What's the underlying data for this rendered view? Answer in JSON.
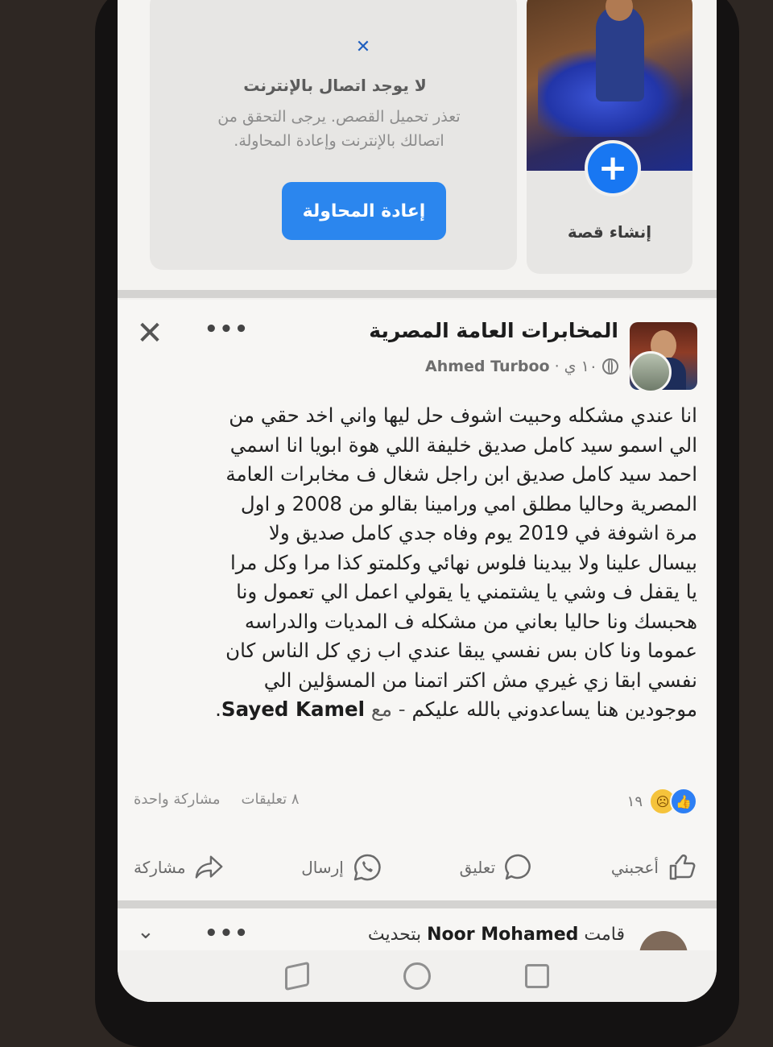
{
  "stories": {
    "error": {
      "icon": "close-icon",
      "title": "لا يوجد اتصال بالإنترنت",
      "message_line1": "تعذر تحميل القصص. يرجى التحقق من",
      "message_line2": "اتصالك بالإنترنت وإعادة المحاولة.",
      "retry_label": "إعادة المحاولة"
    },
    "create": {
      "label": "إنشاء قصة",
      "plus": "+"
    }
  },
  "post": {
    "page_name": "المخابرات العامة المصرية",
    "time": "١٠ ي",
    "author": "Ahmed Turboo",
    "text_lines": [
      "انا عندي مشكله وحبيت اشوف حل ليها واني اخد حقي من",
      "الي اسمو سيد كامل صديق خليفة اللي هوة ابويا انا اسمي",
      "احمد سيد كامل صديق ابن راجل شغال ف مخابرات العامة",
      "المصرية وحاليا مطلق امي ورامينا بقالو من 2008 و اول",
      "مرة اشوفة في 2019 يوم وفاه جدي كامل صديق ولا",
      "بيسال علينا ولا بيدينا فلوس نهائي وكلمتو كذا مرا وكل مرا",
      "يا يقفل ف وشي يا يشتمني يا يقولي اعمل الي تعمول ونا",
      "هحبسك ونا حاليا بعاني من مشكله ف المديات والدراسه",
      "عموما ونا كان بس نفسي يبقا عندي اب زي كل الناس كان",
      "نفسي ابقا زي غيري مش اكتر اتمنا من المسؤلين الي",
      "موجودين هنا يساعدوني بالله عليكم"
    ],
    "with_label": "- مع",
    "tagged_user": "Sayed Kamel",
    "tag_end": ".",
    "reaction_count": "١٩",
    "comments": "٨ تعليقات",
    "shares": "مشاركة واحدة",
    "actions": {
      "like": "أعجبني",
      "comment": "تعليق",
      "send": "إرسال",
      "share": "مشاركة"
    }
  },
  "next_post": {
    "prefix": "قامت",
    "name": "Noor Mohamed",
    "suffix": "بتحديث"
  },
  "colors": {
    "accent": "#1877f2",
    "retry_button": "#2b86ee",
    "like_reaction": "#2d7ff4",
    "sad_reaction": "#f5c33b"
  }
}
